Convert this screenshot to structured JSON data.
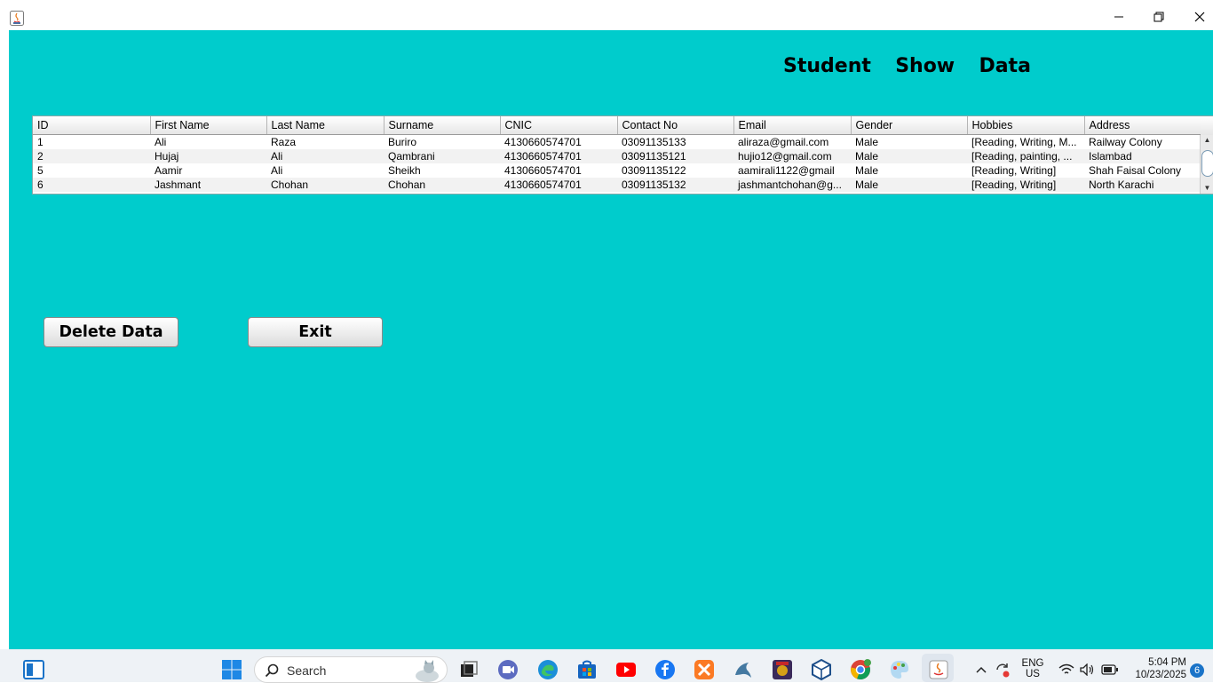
{
  "window": {
    "title": ""
  },
  "page": {
    "title": "Student  Show  Data"
  },
  "table": {
    "columns": [
      "ID",
      "First Name",
      "Last Name",
      "Surname",
      "CNIC",
      "Contact No",
      "Email",
      "Gender",
      "Hobbies",
      "Address"
    ],
    "rows": [
      [
        "1",
        "Ali",
        "Raza",
        "Buriro",
        "4130660574701",
        "03091135133",
        "aliraza@gmail.com",
        "Male",
        "[Reading, Writing, M...",
        "Railway Colony"
      ],
      [
        "2",
        "Hujaj",
        "Ali",
        "Qambrani",
        "4130660574701",
        "03091135121",
        "hujio12@gmail.com",
        "Male",
        "[Reading, painting, ...",
        "Islambad"
      ],
      [
        "5",
        "Aamir",
        "Ali",
        "Sheikh",
        "4130660574701",
        "03091135122",
        "aamirali1122@gmail",
        "Male",
        "[Reading, Writing]",
        "Shah Faisal Colony"
      ],
      [
        "6",
        "Jashmant",
        "Chohan",
        "Chohan",
        "4130660574701",
        "03091135132",
        "jashmantchohan@g...",
        "Male",
        "[Reading, Writing]",
        "North Karachi"
      ]
    ]
  },
  "buttons": {
    "delete_label": "Delete Data",
    "exit_label": "Exit"
  },
  "taskbar": {
    "search_placeholder": "Search",
    "language": "ENG",
    "region": "US",
    "time": "5:04 PM",
    "date": "10/23/2025",
    "notification_count": "6"
  },
  "colors": {
    "background": "#00cccc",
    "taskbar": "#eef2f6"
  }
}
